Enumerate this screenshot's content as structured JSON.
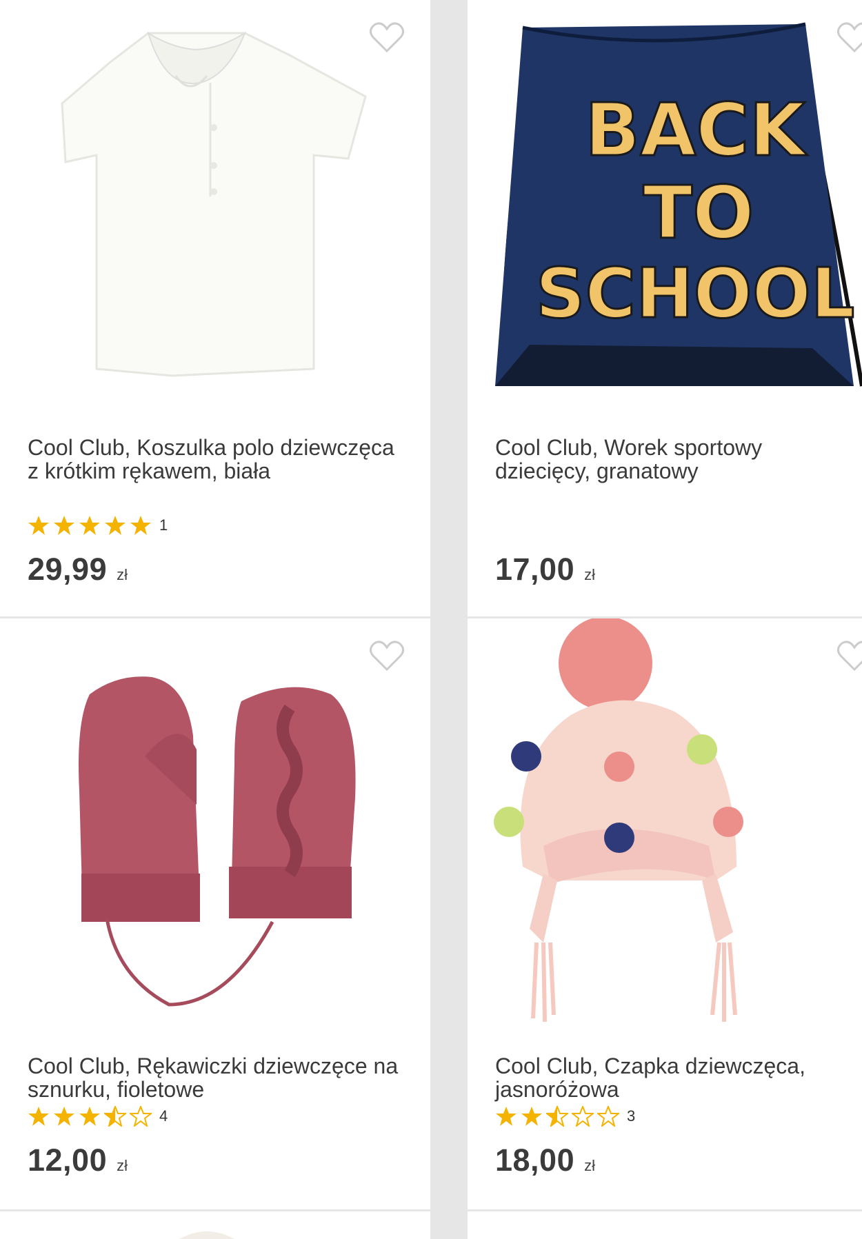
{
  "products": [
    {
      "title": "Cool Club, Koszulka polo dziewczęca z krótkim rękawem, biała",
      "rating_stars": 5,
      "rating_count": "1",
      "price": "29,99",
      "currency": "zł",
      "image_icon": "white-polo-shirt"
    },
    {
      "title": "Cool Club, Worek sportowy dziecięcy, granatowy",
      "price": "17,00",
      "currency": "zł",
      "image_icon": "drawstring-bag",
      "image_text": [
        "BACK",
        "TO",
        "SCHOOL"
      ]
    },
    {
      "title": "Cool Club, Rękawiczki dziewczęce na sznurku, fioletowe",
      "rating_stars": 2.5,
      "rating_count": "4",
      "price": "12,00",
      "currency": "zł",
      "image_icon": "knit-mittens"
    },
    {
      "title": "Cool Club, Czapka dziewczęca, jasnoróżowa",
      "rating_stars": 2.5,
      "rating_count": "3",
      "price": "18,00",
      "currency": "zł",
      "image_icon": "pompom-hat"
    }
  ],
  "colors": {
    "star": "#f5b301",
    "heart": "#cccccc",
    "bag": "#1f3566",
    "bag_text": "#f2c46a"
  }
}
